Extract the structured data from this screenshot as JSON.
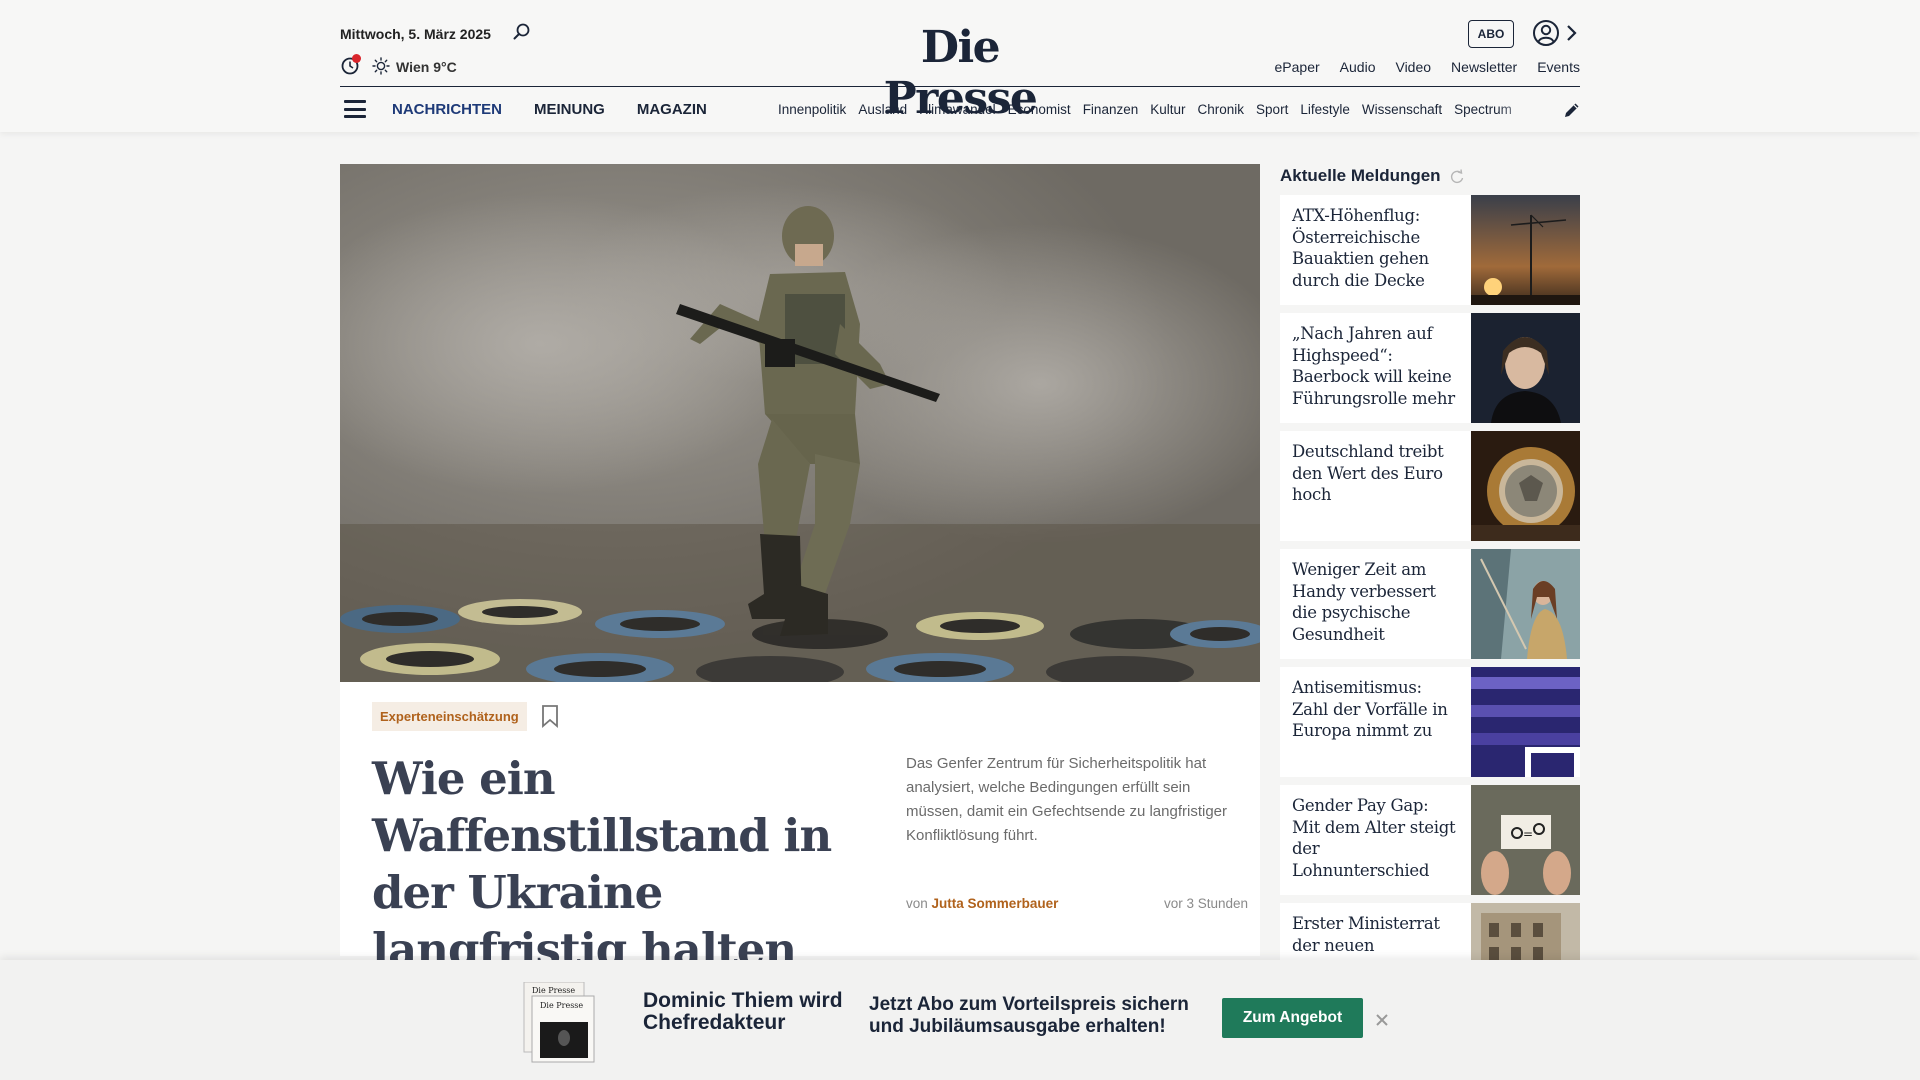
{
  "header": {
    "date": "Mittwoch, 5. März 2025",
    "weather": "Wien 9°C",
    "logo": "Die Presse",
    "abo_label": "ABO",
    "top_links": [
      "ePaper",
      "Audio",
      "Video",
      "Newsletter",
      "Events"
    ],
    "main_nav": [
      "NACHRICHTEN",
      "MEINUNG",
      "MAGAZIN"
    ],
    "sub_nav": [
      "Innenpolitik",
      "Ausland",
      "Klimawandel",
      "Economist",
      "Finanzen",
      "Kultur",
      "Chronik",
      "Sport",
      "Lifestyle",
      "Wissenschaft",
      "Spectrum"
    ]
  },
  "hero": {
    "tag": "Experteneinschätzung",
    "headline": "Wie ein Waffenstillstand in der Ukraine langfristig halten könnte",
    "teaser": "Das Genfer Zentrum für Sicherheitspolitik hat analysiert, welche Bedingungen erfüllt sein müssen, damit ein Gefechtsende zu langfristiger Konfliktlösung führt.",
    "byline_prefix": "von",
    "author": "Jutta Sommerbauer",
    "time_ago": "vor 3 Stunden"
  },
  "sidebar": {
    "title": "Aktuelle Meldungen",
    "items": [
      {
        "title": "ATX-Höhenflug: Österreichische Bauaktien gehen durch die Decke"
      },
      {
        "title": "„Nach Jahren auf Highspeed“: Baerbock will keine Führungsrolle mehr"
      },
      {
        "title": "Deutschland treibt den Wert des Euro hoch"
      },
      {
        "title": "Weniger Zeit am Handy verbessert die psychische Gesundheit"
      },
      {
        "title": "Antisemitismus: Zahl der Vorfälle in Europa nimmt zu"
      },
      {
        "title": "Gender Pay Gap: Mit dem Alter steigt der Lohnunterschied"
      },
      {
        "title": "Erster Ministerrat der neuen"
      }
    ]
  },
  "banner": {
    "name": "Dominic Thiem wird Chefredakteur",
    "offer": "Jetzt Abo zum Vorteilspreis sichern und Jubiläumsausgabe erhalten!",
    "cta": "Zum Angebot"
  },
  "colors": {
    "accent_orange": "#b0621c",
    "navy": "#1b2538",
    "cta_green": "#1f7a5a",
    "notification_red": "#d9252b"
  }
}
